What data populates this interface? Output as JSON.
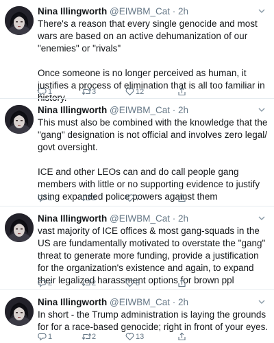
{
  "tweets": [
    {
      "name": "Nina Illingworth",
      "handle": "@EIWBM_Cat",
      "separator": "·",
      "time": "2h",
      "text": "There's a reason that every single genocide and most wars are based on an active dehumanization of our \"enemies\" or \"rivals\"\n\nOnce someone is no longer perceived as human, it justifies a process of elimination that is all too familiar in history.",
      "replies": "1",
      "retweets": "3",
      "likes": "12"
    },
    {
      "name": "Nina Illingworth",
      "handle": "@EIWBM_Cat",
      "separator": "·",
      "time": "2h",
      "text": "This must also be combined with the knowledge that the \"gang\" designation is not official and involves zero legal/ govt oversight.\n\nICE and other LEOs can and do call people gang members with little or no supporting evidence to justify using expanded police powers against them",
      "replies": "1",
      "retweets": "2",
      "likes": "7"
    },
    {
      "name": "Nina Illingworth",
      "handle": "@EIWBM_Cat",
      "separator": "·",
      "time": "2h",
      "text": "vast majority of ICE offices & most gang-squads in the US are fundamentally motivated to overstate the \"gang\" threat to generate more funding, provide a justification for the organization's existence and again, to expand their legalized harassment options for brown ppl",
      "replies": "2",
      "retweets": "2",
      "likes": "8"
    },
    {
      "name": "Nina Illingworth",
      "handle": "@EIWBM_Cat",
      "separator": "·",
      "time": "2h",
      "text": "In short - the Trump administration is laying the grounds for for a race-based genocide; right in front of your eyes.",
      "replies": "1",
      "retweets": "2",
      "likes": "13"
    }
  ],
  "icons": {
    "reply": "reply-icon",
    "retweet": "retweet-icon",
    "like": "heart-icon",
    "share": "share-icon",
    "menu": "chevron-down-icon"
  },
  "colors": {
    "text": "#14171a",
    "secondary": "#657786",
    "divider": "#e6ecf0"
  }
}
